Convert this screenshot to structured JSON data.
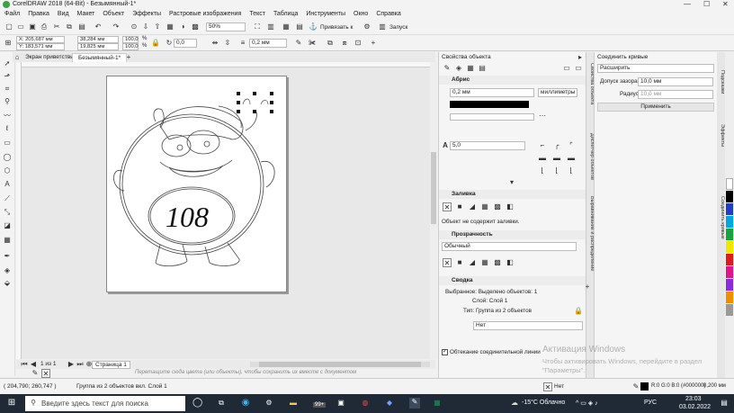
{
  "window": {
    "title": "CorelDRAW 2018 (64-Bit) - Безымянный-1*"
  },
  "menu": [
    "Файл",
    "Правка",
    "Вид",
    "Макет",
    "Объект",
    "Эффекты",
    "Растровые изображения",
    "Текст",
    "Таблица",
    "Инструменты",
    "Окно",
    "Справка"
  ],
  "toolbar": {
    "zoom": "50%",
    "snap_label": "Привязать к",
    "launch_label": "Запуск"
  },
  "propbar": {
    "x": "X: 205,687 мм",
    "y": "Y: 183,571 мм",
    "w": "38,284 мм",
    "h": "19,825 мм",
    "sx": "100,0",
    "sy": "100,0",
    "pct": "%",
    "angle": "0,0",
    "outline": "0,2 мм"
  },
  "tabs": {
    "welcome": "Экран приветствия",
    "doc": "Безымянный-1*"
  },
  "canvas": {
    "number": "108",
    "page_nav": "1 из 1",
    "page_tab": "Страница 1",
    "hint": "Перетащите сюда цвета (или объекты), чтобы сохранить их вместе с документом"
  },
  "props": {
    "title": "Свойства объекта",
    "outline_section": "Абрис",
    "outline_width": "0,2 мм",
    "units": "миллиметры",
    "font_size": "5,0",
    "fill_section": "Заливка",
    "fill_text": "Объект не содержит заливки.",
    "transp_section": "Прозрачность",
    "transp_mode": "Обычный",
    "summary_section": "Сводка",
    "summary_selected": "Выбранное: Выделено объектов: 1",
    "summary_layer": "Слой: Слой 1",
    "summary_type": "Тип: Группа из 2 объектов",
    "wrap_value": "Нет",
    "wrap_connector": "Обтекание соединительной линии"
  },
  "vtabs": [
    "Свойства объекта",
    "Диспетчер объектов",
    "Выравнивание и распределение"
  ],
  "connect": {
    "title": "Соединить кривые",
    "mode": "Расширить",
    "gap_label": "Допуск зазора:",
    "gap_value": "10,0 мм",
    "radius_label": "Радиус:",
    "radius_value": "10,0 мм",
    "apply": "Применить"
  },
  "rtabs": [
    "Подсказки",
    "Соединить кривые",
    "Эффекты"
  ],
  "status": {
    "coords": "( 204,790; 260,747 )",
    "info": "Группа из 2 объектов вкл. Слой 1",
    "fill": "Нет",
    "outline": "R:0 G:0 B:0 (#000000)",
    "outline_w": "0,200 мм"
  },
  "watermark": {
    "line1": "Активация Windows",
    "line2": "Чтобы активировать Windows, перейдите в раздел",
    "line3": "\"Параметры\"."
  },
  "taskbar": {
    "search": "Введите здесь текст для поиска",
    "weather": "-15°C Облачно",
    "lang": "РУС",
    "time": "23:03",
    "date": "03.02.2022",
    "badge": "99+"
  },
  "colors": {
    "accent": "#3c78d8",
    "taskbar": "#1f2a36"
  }
}
